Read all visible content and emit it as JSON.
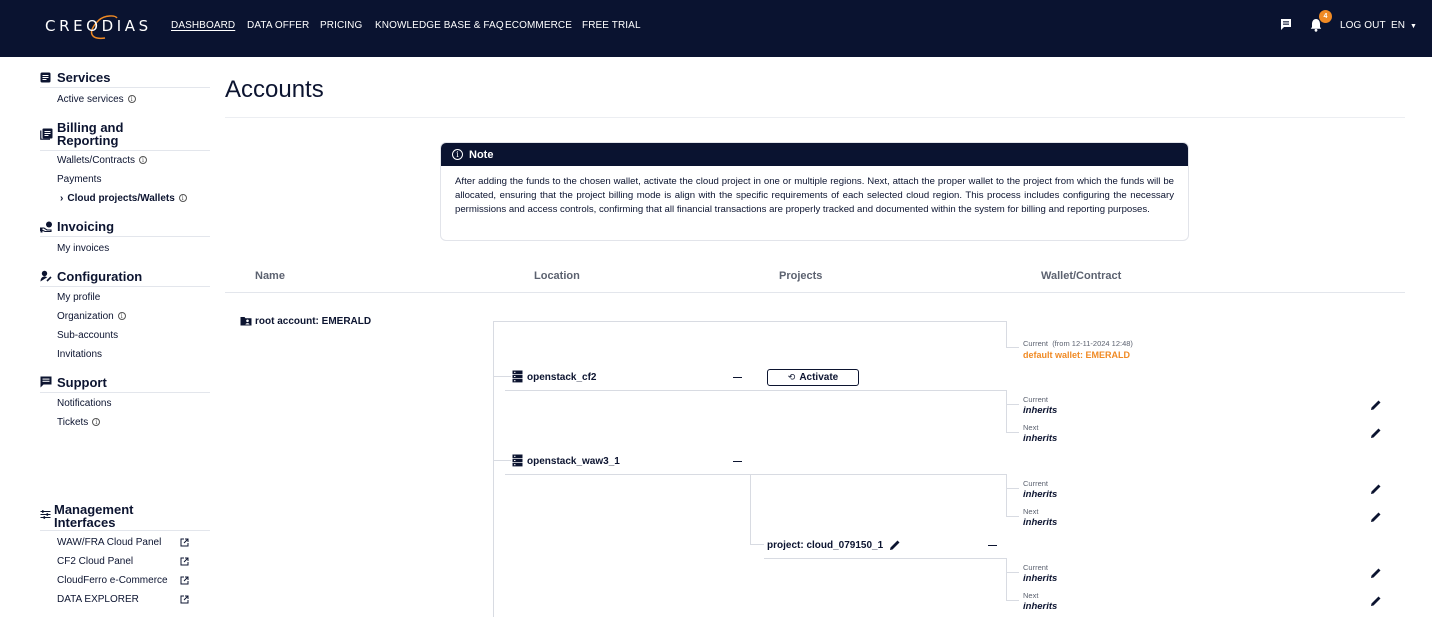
{
  "brand": {
    "logo_text": "CREODIAS",
    "accent": "#f08a24",
    "nav_bg": "#0a1330"
  },
  "topnav": {
    "items": [
      "DASHBOARD",
      "DATA OFFER",
      "PRICING",
      "KNOWLEDGE BASE & FAQ",
      "ECOMMERCE",
      "FREE TRIAL"
    ],
    "active_index": 0,
    "notification_count": "4",
    "logout": "LOG OUT",
    "language": "EN"
  },
  "sidebar": {
    "services": {
      "title": "Services",
      "items": [
        "Active services"
      ]
    },
    "billing": {
      "title_line1": "Billing and",
      "title_line2": "Reporting",
      "items": [
        "Wallets/Contracts",
        "Payments",
        "Cloud projects/Wallets"
      ],
      "current_prefix": "›"
    },
    "invoicing": {
      "title": "Invoicing",
      "items": [
        "My invoices"
      ]
    },
    "configuration": {
      "title": "Configuration",
      "items": [
        "My profile",
        "Organization",
        "Sub-accounts",
        "Invitations"
      ]
    },
    "support": {
      "title": "Support",
      "items": [
        "Notifications",
        "Tickets"
      ]
    },
    "management": {
      "title_line1": "Management",
      "title_line2": "Interfaces",
      "items": [
        "WAW/FRA Cloud Panel",
        "CF2 Cloud Panel",
        "CloudFerro e-Commerce",
        "DATA EXPLORER"
      ]
    }
  },
  "main": {
    "title": "Accounts",
    "note": {
      "title": "Note",
      "text": "After adding the funds to the chosen wallet, activate the cloud project in one or multiple regions. Next, attach the proper wallet to the project from which the funds will be allocated, ensuring that the project billing mode is align with the specific requirements of each selected cloud region. This process includes configuring the necessary permissions and access controls, confirming that all financial transactions are properly tracked and documented within the system for billing and reporting purposes."
    },
    "columns": [
      "Name",
      "Location",
      "Projects",
      "Wallet/Contract"
    ],
    "root": {
      "label": "root account: EMERALD",
      "current_label": "Current",
      "current_since": "(from 12-11-2024 12:48)",
      "wallet": "default wallet: EMERALD"
    },
    "regions": [
      {
        "name": "openstack_cf2",
        "collapse": "–",
        "action": "Activate",
        "current_label": "Current",
        "current_value": "inherits",
        "next_label": "Next",
        "next_value": "inherits"
      },
      {
        "name": "openstack_waw3_1",
        "collapse": "–",
        "current_label": "Current",
        "current_value": "inherits",
        "next_label": "Next",
        "next_value": "inherits"
      }
    ],
    "project": {
      "label": "project: cloud_079150_1",
      "collapse": "–",
      "current_label": "Current",
      "current_value": "inherits",
      "next_label": "Next",
      "next_value": "inherits"
    }
  }
}
